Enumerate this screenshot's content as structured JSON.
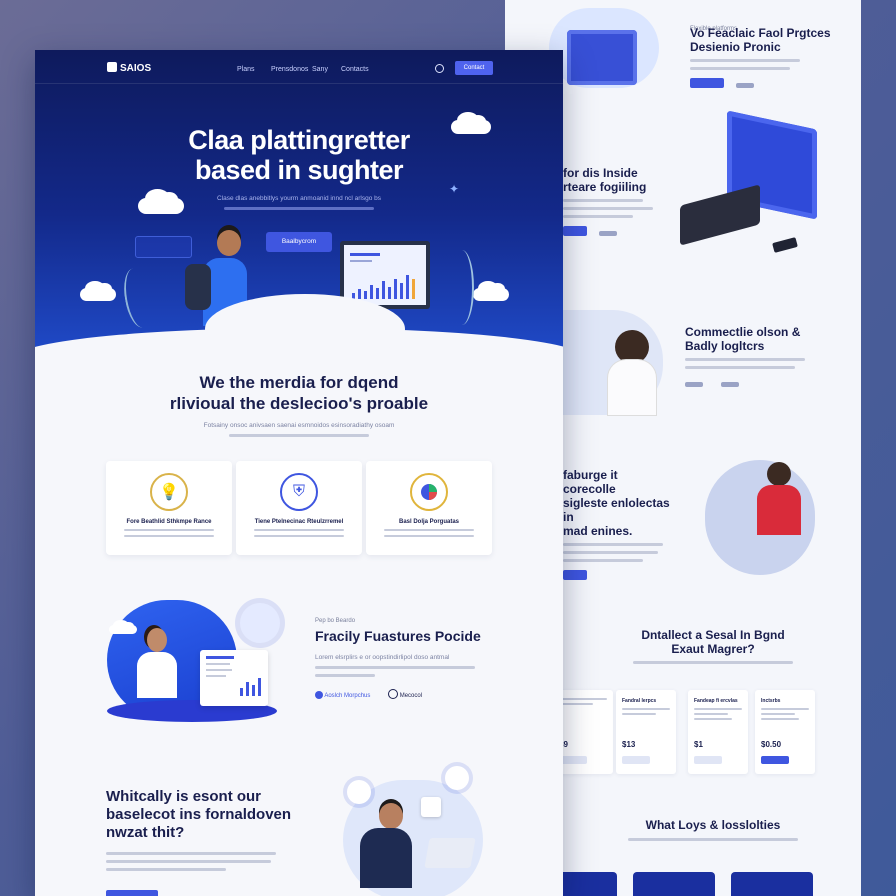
{
  "back_page": {
    "section1": {
      "eyebrow": "Flexible platforms",
      "title_line1": "Vo Feaclaic Faol Prgtces",
      "title_line2": "Desienio Pronic"
    },
    "section2": {
      "title_line1": "for dis Inside",
      "title_line2": "rteare fogiiling"
    },
    "section3": {
      "title_line1": "Commectlie olson &",
      "title_line2": "Badly logltcrs"
    },
    "section4": {
      "title_line1": "faburge it corecolle",
      "title_line2": "sigleste enlolectas in",
      "title_line3": "mad enines."
    },
    "pricing": {
      "title_line1": "Dntallect a Sesal In Bgnd",
      "title_line2": "Exaut Magrer?",
      "plans": [
        {
          "name": "",
          "price": "$9"
        },
        {
          "name": "Fandral lerpcs",
          "price": "$13"
        },
        {
          "name": "Fandeap fi ercvlas",
          "price": "$1"
        },
        {
          "name": "Inctsrbs",
          "price": "$0.50"
        }
      ]
    },
    "footer": {
      "title": "What Loys & losslolties"
    }
  },
  "nav": {
    "logo": "SAIOS",
    "links": [
      "Plans",
      "Prensdonos",
      "Sany",
      "Contacts"
    ],
    "cta": "Contact"
  },
  "hero": {
    "title_line1": "Claa plattingretter",
    "title_line2": "based in sughter",
    "subtitle": "Clase dlas anebbitlys yourm anmoanid innd ncl arlsgo bs",
    "cta": "Baalbycrom"
  },
  "about": {
    "title_line1": "We the merdia for dqend",
    "title_line2": "rlivioual the deslecioo's proable",
    "body": "Fotsainy onsoc anivsaen saenai esmnoidos esinsoradiathy osoam"
  },
  "feature_cards": [
    {
      "title": "Fore Beathlid Sthkmpe Rance",
      "icon": "lightbulb-icon"
    },
    {
      "title": "Tiene Ptelnecinac Rteulzrremel",
      "icon": "shield-icon"
    },
    {
      "title": "Basl Dolja Porguatas",
      "icon": "pie-chart-icon"
    }
  ],
  "features": {
    "eyebrow": "Pep bo Beardo",
    "title": "Fracily Fuastures Pocide",
    "body": "Lorem elsrplirs e or oopstindirlipol doso antmal",
    "link1": "Aoslch Morpchus",
    "link2": "Mecocol"
  },
  "cta_section": {
    "title_line1": "Whitcally is esont our",
    "title_line2": "baselecot ins fornaldoven",
    "title_line3": "nwzat thit?"
  },
  "colors": {
    "hero_dark": "#0e1a5c",
    "accent": "#3f56e0",
    "background": "#f6f7fb"
  }
}
